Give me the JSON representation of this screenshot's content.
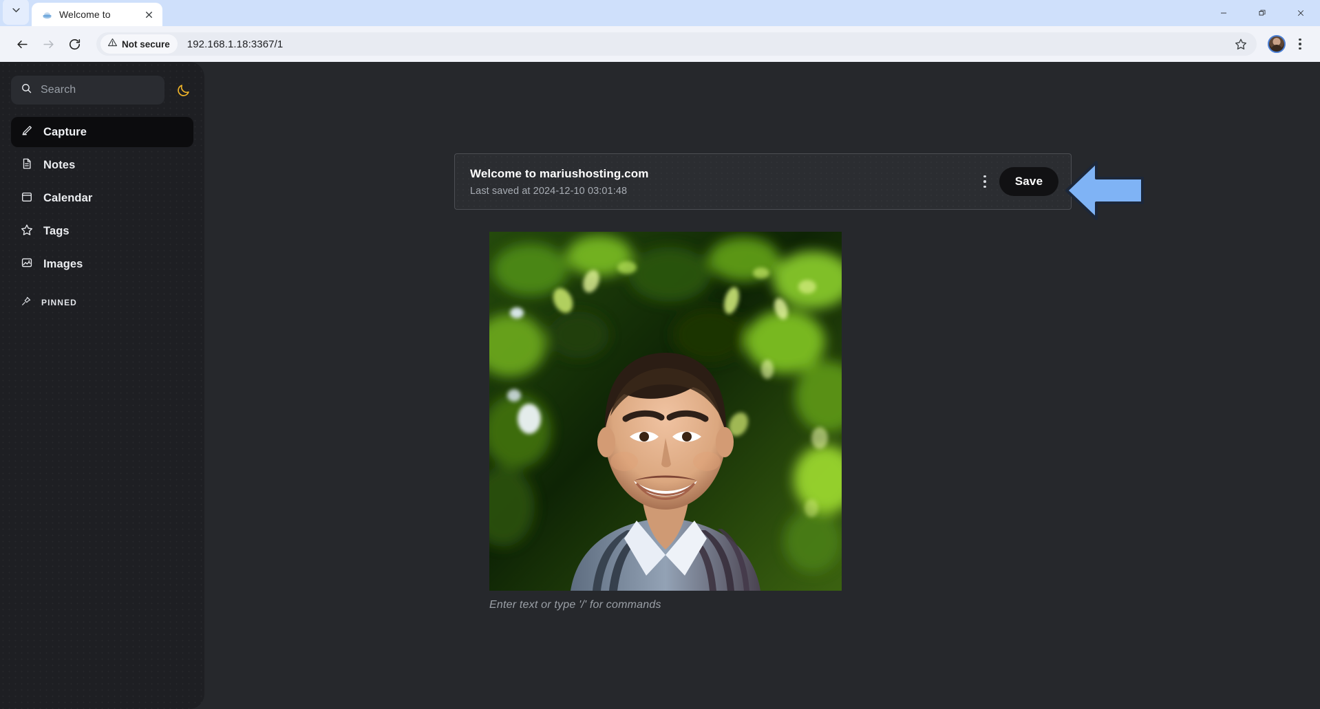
{
  "browser": {
    "tab": {
      "title": "Welcome to",
      "favicon": "cloud-favicon"
    },
    "tabstrip_leading_icon": "chevron-down-icon",
    "nav": {
      "back": "back-arrow-icon",
      "forward": "forward-arrow-icon",
      "reload": "reload-icon"
    },
    "omnibox": {
      "security_label": "Not secure",
      "security_icon": "warning-triangle-icon",
      "url": "192.168.1.18:3367/1",
      "bookmark_icon": "star-icon"
    },
    "profile_avatar": "user-avatar",
    "menu_icon": "three-dots-vertical-icon",
    "window_controls": {
      "minimize": "minimize-icon",
      "restore": "restore-icon",
      "close": "close-icon"
    }
  },
  "sidebar": {
    "search": {
      "placeholder": "Search",
      "icon": "search-icon"
    },
    "theme_toggle": {
      "icon": "moon-icon",
      "color": "#f0b429"
    },
    "items": [
      {
        "label": "Capture",
        "icon": "pencil-icon",
        "active": true
      },
      {
        "label": "Notes",
        "icon": "document-icon",
        "active": false
      },
      {
        "label": "Calendar",
        "icon": "calendar-icon",
        "active": false
      },
      {
        "label": "Tags",
        "icon": "star-icon",
        "active": false
      },
      {
        "label": "Images",
        "icon": "image-icon",
        "active": false
      }
    ],
    "section": {
      "title": "PINNED",
      "icon": "pin-icon"
    }
  },
  "note": {
    "title": "Welcome to mariushosting.com",
    "last_saved": "Last saved at 2024-12-10 03:01:48",
    "menu_icon": "three-dots-vertical-icon",
    "save_label": "Save"
  },
  "editor": {
    "placeholder": "Enter text or type '/' for commands",
    "image_alt": "portrait-photo-of-man-smiling-in-front-of-green-foliage"
  },
  "annotation": {
    "arrow": "left-pointing-arrow",
    "fill": "#7fb3f5",
    "stroke": "#1c2739"
  },
  "colors": {
    "sidebar_bg": "#1e1f23",
    "main_bg": "#26282c",
    "card_bg": "#2b2d31",
    "active_item_bg": "#0c0c0e",
    "save_btn_bg": "#111113"
  }
}
